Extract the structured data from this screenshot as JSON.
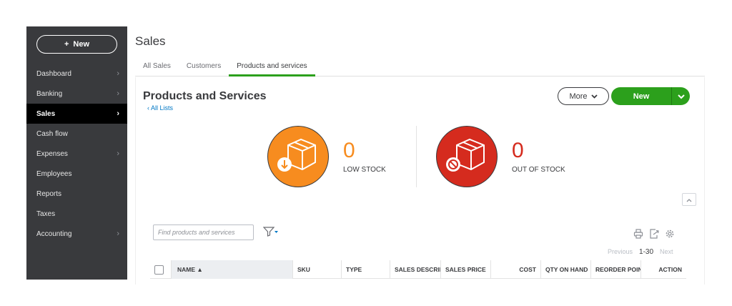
{
  "sidebar": {
    "new_label": "New",
    "items": [
      {
        "label": "Dashboard",
        "chevron": true,
        "active": false
      },
      {
        "label": "Banking",
        "chevron": true,
        "active": false
      },
      {
        "label": "Sales",
        "chevron": true,
        "active": true
      },
      {
        "label": "Cash flow",
        "chevron": false,
        "active": false
      },
      {
        "label": "Expenses",
        "chevron": true,
        "active": false
      },
      {
        "label": "Employees",
        "chevron": false,
        "active": false
      },
      {
        "label": "Reports",
        "chevron": false,
        "active": false
      },
      {
        "label": "Taxes",
        "chevron": false,
        "active": false
      },
      {
        "label": "Accounting",
        "chevron": true,
        "active": false
      }
    ]
  },
  "page": {
    "title": "Sales",
    "tabs": [
      {
        "label": "All Sales",
        "active": false
      },
      {
        "label": "Customers",
        "active": false
      },
      {
        "label": "Products and services",
        "active": true
      }
    ]
  },
  "content": {
    "title": "Products and Services",
    "all_lists": "All Lists",
    "more_label": "More",
    "new_label": "New",
    "low_stock": {
      "count": "0",
      "label": "LOW STOCK"
    },
    "out_of_stock": {
      "count": "0",
      "label": "OUT OF STOCK"
    },
    "search_placeholder": "Find products and services",
    "pager": {
      "previous": "Previous",
      "range": "1-30",
      "next": "Next"
    },
    "columns": [
      "NAME ▲",
      "SKU",
      "TYPE",
      "SALES DESCRIPTION",
      "SALES PRICE",
      "COST",
      "QTY ON HAND",
      "REORDER POINT",
      "ACTION"
    ]
  },
  "colors": {
    "sidebar_bg": "#393a3d",
    "accent_green": "#2ca01c",
    "low_stock_orange": "#f78c1f",
    "out_of_stock_red": "#d52b1e",
    "link_blue": "#0077c5"
  }
}
